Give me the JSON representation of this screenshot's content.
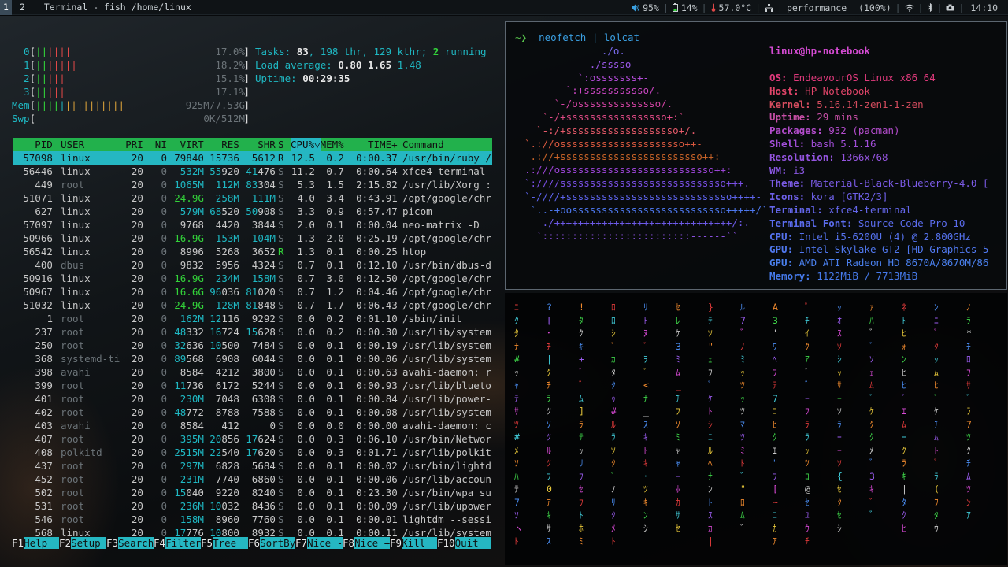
{
  "topbar": {
    "workspaces": [
      "1",
      "2"
    ],
    "active_workspace": "1",
    "window_title": "Terminal - fish /home/linux",
    "volume": "95%",
    "battery": "14%",
    "temperature": "57.0°C",
    "governor": "performance",
    "governor_pct": "(100%)",
    "time": "14:10"
  },
  "htop": {
    "cpus": [
      {
        "label": "0",
        "pct": "17.0%",
        "bars": [
          [
            "g",
            "||"
          ],
          [
            "r",
            "||||"
          ]
        ]
      },
      {
        "label": "1",
        "pct": "18.2%",
        "bars": [
          [
            "g",
            "||"
          ],
          [
            "r",
            "|||||"
          ]
        ]
      },
      {
        "label": "2",
        "pct": "15.1%",
        "bars": [
          [
            "g",
            "||"
          ],
          [
            "r",
            "|||"
          ]
        ]
      },
      {
        "label": "3",
        "pct": "17.1%",
        "bars": [
          [
            "g",
            "||"
          ],
          [
            "r",
            "|||"
          ]
        ]
      }
    ],
    "mem": {
      "label": "Mem",
      "value": "925M/7.53G",
      "bars": [
        [
          "g",
          "||||"
        ],
        [
          "c",
          "|"
        ],
        [
          "o",
          "||||||||||"
        ]
      ]
    },
    "swp": {
      "label": "Swp",
      "value": "0K/512M"
    },
    "tasks_label": "Tasks: ",
    "tasks": "83",
    "tasks_rest": ", 198 thr, 129 kthr; ",
    "running": "2",
    "running_label": " running",
    "load_label": "Load average: ",
    "load1": "0.80",
    "load5": "1.65",
    "load15": "1.48",
    "uptime_label": "Uptime: ",
    "uptime": "00:29:35",
    "columns": [
      "PID",
      "USER",
      "PRI",
      "NI",
      "VIRT",
      "RES",
      "SHR",
      "S",
      "CPU%▽",
      "MEM%",
      "TIME+",
      "Command"
    ],
    "processes": [
      [
        "57098",
        "linux",
        "20",
        "0",
        "79840",
        "15736",
        "5612",
        "R",
        "12.5",
        "0.2",
        "0:00.37",
        "/usr/bin/ruby /"
      ],
      [
        "56446",
        "linux",
        "20",
        "0",
        "532M",
        "55920",
        "41476",
        "S",
        "11.2",
        "0.7",
        "0:00.64",
        "xfce4-terminal"
      ],
      [
        "449",
        "root",
        "20",
        "0",
        "1065M",
        "112M",
        "83304",
        "S",
        "5.3",
        "1.5",
        "2:15.82",
        "/usr/lib/Xorg :"
      ],
      [
        "51071",
        "linux",
        "20",
        "0",
        "24.9G",
        "258M",
        "111M",
        "S",
        "4.0",
        "3.4",
        "0:43.91",
        "/opt/google/chr"
      ],
      [
        "627",
        "linux",
        "20",
        "0",
        "579M",
        "68520",
        "50908",
        "S",
        "3.3",
        "0.9",
        "0:57.47",
        "picom"
      ],
      [
        "57097",
        "linux",
        "20",
        "0",
        "9768",
        "4420",
        "3844",
        "S",
        "2.0",
        "0.1",
        "0:00.04",
        "neo-matrix -D"
      ],
      [
        "50966",
        "linux",
        "20",
        "0",
        "16.9G",
        "153M",
        "104M",
        "S",
        "1.3",
        "2.0",
        "0:25.19",
        "/opt/google/chr"
      ],
      [
        "56542",
        "linux",
        "20",
        "0",
        "8996",
        "5268",
        "3652",
        "R",
        "1.3",
        "0.1",
        "0:00.25",
        "htop"
      ],
      [
        "400",
        "dbus",
        "20",
        "0",
        "9832",
        "5956",
        "4324",
        "S",
        "0.7",
        "0.1",
        "0:12.10",
        "/usr/bin/dbus-d"
      ],
      [
        "50916",
        "linux",
        "20",
        "0",
        "16.9G",
        "234M",
        "158M",
        "S",
        "0.7",
        "3.0",
        "0:12.50",
        "/opt/google/chr"
      ],
      [
        "50967",
        "linux",
        "20",
        "0",
        "16.6G",
        "96036",
        "81020",
        "S",
        "0.7",
        "1.2",
        "0:04.46",
        "/opt/google/chr"
      ],
      [
        "51032",
        "linux",
        "20",
        "0",
        "24.9G",
        "128M",
        "81848",
        "S",
        "0.7",
        "1.7",
        "0:06.43",
        "/opt/google/chr"
      ],
      [
        "1",
        "root",
        "20",
        "0",
        "162M",
        "12116",
        "9292",
        "S",
        "0.0",
        "0.2",
        "0:01.10",
        "/sbin/init"
      ],
      [
        "237",
        "root",
        "20",
        "0",
        "48332",
        "16724",
        "15628",
        "S",
        "0.0",
        "0.2",
        "0:00.30",
        "/usr/lib/system"
      ],
      [
        "250",
        "root",
        "20",
        "0",
        "32636",
        "10500",
        "7484",
        "S",
        "0.0",
        "0.1",
        "0:00.19",
        "/usr/lib/system"
      ],
      [
        "368",
        "systemd-ti",
        "20",
        "0",
        "89568",
        "6908",
        "6044",
        "S",
        "0.0",
        "0.1",
        "0:00.06",
        "/usr/lib/system"
      ],
      [
        "398",
        "avahi",
        "20",
        "0",
        "8584",
        "4212",
        "3800",
        "S",
        "0.0",
        "0.1",
        "0:00.63",
        "avahi-daemon: r"
      ],
      [
        "399",
        "root",
        "20",
        "0",
        "11736",
        "6172",
        "5244",
        "S",
        "0.0",
        "0.1",
        "0:00.93",
        "/usr/lib/blueto"
      ],
      [
        "401",
        "root",
        "20",
        "0",
        "230M",
        "7048",
        "6308",
        "S",
        "0.0",
        "0.1",
        "0:00.84",
        "/usr/lib/power-"
      ],
      [
        "402",
        "root",
        "20",
        "0",
        "48772",
        "8788",
        "7588",
        "S",
        "0.0",
        "0.1",
        "0:00.08",
        "/usr/lib/system"
      ],
      [
        "403",
        "avahi",
        "20",
        "0",
        "8584",
        "412",
        "0",
        "S",
        "0.0",
        "0.0",
        "0:00.00",
        "avahi-daemon: c"
      ],
      [
        "407",
        "root",
        "20",
        "0",
        "395M",
        "20856",
        "17624",
        "S",
        "0.0",
        "0.3",
        "0:06.10",
        "/usr/bin/Networ"
      ],
      [
        "408",
        "polkitd",
        "20",
        "0",
        "2515M",
        "22540",
        "17620",
        "S",
        "0.0",
        "0.3",
        "0:01.71",
        "/usr/lib/polkit"
      ],
      [
        "437",
        "root",
        "20",
        "0",
        "297M",
        "6828",
        "5684",
        "S",
        "0.0",
        "0.1",
        "0:00.02",
        "/usr/bin/lightd"
      ],
      [
        "452",
        "root",
        "20",
        "0",
        "231M",
        "7740",
        "6860",
        "S",
        "0.0",
        "0.1",
        "0:00.06",
        "/usr/lib/accoun"
      ],
      [
        "502",
        "root",
        "20",
        "0",
        "15040",
        "9220",
        "8240",
        "S",
        "0.0",
        "0.1",
        "0:23.30",
        "/usr/bin/wpa_su"
      ],
      [
        "531",
        "root",
        "20",
        "0",
        "236M",
        "10032",
        "8436",
        "S",
        "0.0",
        "0.1",
        "0:00.09",
        "/usr/lib/upower"
      ],
      [
        "546",
        "root",
        "20",
        "0",
        "158M",
        "8960",
        "7760",
        "S",
        "0.0",
        "0.1",
        "0:00.01",
        "lightdm --sessi"
      ],
      [
        "568",
        "linux",
        "20",
        "0",
        "17776",
        "10800",
        "8932",
        "S",
        "0.0",
        "0.1",
        "0:00.11",
        "/usr/lib/system"
      ]
    ],
    "fkeys": [
      [
        "F1",
        "Help  "
      ],
      [
        "F2",
        "Setup "
      ],
      [
        "F3",
        "Search"
      ],
      [
        "F4",
        "Filter"
      ],
      [
        "F5",
        "Tree  "
      ],
      [
        "F6",
        "SortBy"
      ],
      [
        "F7",
        "Nice -"
      ],
      [
        "F8",
        "Nice +"
      ],
      [
        "F9",
        "Kill  "
      ],
      [
        "F10",
        "Quit  "
      ]
    ]
  },
  "neofetch": {
    "prompt": "~❯",
    "command": "neofetch | lolcat",
    "logo": [
      "             ./o.",
      "           ./sssso-",
      "         `:osssssss+-",
      "       `:+sssssssssso/.",
      "     `-/ossssssssssssso/.",
      "   `-/+sssssssssssssssso+:`",
      "  `-:/+sssssssssssssssssso+/.",
      "`.://osssssssssssssssssssso++-",
      " .://+ssssssssssssssssssssssso++:",
      ".:///ossssssssssssssssssssssssso++:",
      "`:////ssssssssssssssssssssssssssso+++.",
      "`-////+ssssssssssssssssssssssssssso++++-",
      " `..-+oossssssssssssssssssssssssso+++++/`",
      "   ./++++++++++++++++++++++++++++++/:.",
      "  `:::::::::::::::::::::::::------``"
    ],
    "user_host": "linux@hp-notebook",
    "separator": "-----------------",
    "info": [
      [
        "OS",
        "EndeavourOS Linux x86_64"
      ],
      [
        "Host",
        "HP Notebook"
      ],
      [
        "Kernel",
        "5.16.14-zen1-1-zen"
      ],
      [
        "Uptime",
        "29 mins"
      ],
      [
        "Packages",
        "932 (pacman)"
      ],
      [
        "Shell",
        "bash 5.1.16"
      ],
      [
        "Resolution",
        "1366x768"
      ],
      [
        "WM",
        "i3"
      ],
      [
        "Theme",
        "Material-Black-Blueberry-4.0 ["
      ],
      [
        "Icons",
        "kora [GTK2/3]"
      ],
      [
        "Terminal",
        "xfce4-terminal"
      ],
      [
        "Terminal Font",
        "Source Code Pro 10"
      ],
      [
        "CPU",
        "Intel i5-6200U (4) @ 2.800GHz"
      ],
      [
        "GPU",
        "Intel Skylake GT2 [HD Graphics 5"
      ],
      [
        "GPU",
        "AMD ATI Radeon HD 8670A/8670M/86"
      ],
      [
        "Memory",
        "1122MiB / 7713MiB"
      ]
    ]
  },
  "matrix": {
    "columns": [
      [
        "ﾆ",
        "ｸ",
        "ﾀ",
        "ﾅ",
        "#",
        "ｯ",
        "ｬ",
        "ﾃ",
        "ｻ",
        "ﾂ",
        "#",
        "ﾒ",
        "ｿ",
        "ﾊ",
        "ﾃ",
        "7",
        "ｿ",
        "ヽ",
        "ﾄ"
      ],
      [
        "?",
        "[",
        "･",
        "ﾁ",
        "|",
        "ｸ",
        "ﾁ",
        "ﾗ",
        "ﾂ",
        "ｿ",
        "ﾂ",
        "ﾙ",
        "ﾂ",
        "ﾌ",
        "0",
        "ｱ",
        "ｷ",
        "ｻ",
        "ｽ"
      ],
      [
        "!",
        "ﾀ",
        "ｸ",
        "ｷ",
        "+",
        "ﾞ",
        "ﾞ",
        "ﾑ",
        "]",
        "ﾗ",
        "ﾃ",
        "ｯ",
        "ﾘ",
        "ﾌ",
        "ｾ",
        "ﾌ",
        "ﾄ",
        "ﾎ",
        "ﾐ"
      ],
      [
        "ﾛ",
        "ﾛ",
        "ｼ",
        "ﾞ",
        "ｶ",
        "ﾀ",
        "ｸ",
        "ｩ",
        "#",
        "ﾙ",
        "ﾗ",
        "ﾂ",
        "ｸ",
        "ﾞ",
        "ﾉ",
        "ﾘ",
        "ｸ",
        "ﾒ",
        "ﾄ"
      ],
      [
        "ﾘ",
        "ﾄ",
        "ﾇ",
        "ﾞ",
        "ｦ",
        "ﾞ",
        "<",
        "ﾅ",
        "_",
        "ｽ",
        "ｷ",
        "ﾄ",
        "ｷ",
        "･",
        "ﾂ",
        "ｷ",
        "ﾝ",
        "ｼ"
      ],
      [
        "ｾ",
        "ﾚ",
        "ｹ",
        "3",
        "ﾐ",
        "ﾑ",
        "_",
        "ﾁ",
        "ﾌ",
        "ｿ",
        "ﾐ",
        "ｬ",
        "ｬ",
        "ｰ",
        "ﾎ",
        "ｶ",
        "ｻ",
        "ｾ"
      ],
      [
        "}",
        "ﾃ",
        "ﾂ",
        "\"",
        "ｪ",
        "ﾌ",
        "ﾞ",
        "ｹ",
        "ﾄ",
        "ｼ",
        "ﾆ",
        "ﾙ",
        "ﾍ",
        "ﾅ",
        "ﾝ",
        "ﾄ",
        "ｽ",
        "ｶ",
        "|"
      ],
      [
        "ﾙ",
        "7",
        "ﾞ",
        "ﾉ",
        "ﾐ",
        "ｯ",
        "ﾂ",
        "ｯ",
        "ﾂ",
        "ﾏ",
        "ﾂ",
        "ﾐ",
        "ﾄ",
        "ﾞ",
        "\"",
        "ﾛ",
        "ﾑ",
        "ﾞ"
      ],
      [
        "A",
        "3",
        "'",
        "ﾜ",
        "ﾍ",
        "ﾌ",
        "ﾃ",
        "7",
        "ｺ",
        "ﾋ",
        "ｸ",
        "ｴ",
        "\"",
        "ﾌ",
        "[",
        "~",
        "ﾆ",
        "ｶ",
        "ｱ"
      ],
      [
        "ﾟ",
        "ﾁ",
        "ｲ",
        "ｸ",
        "ｱ",
        "ﾞ",
        "ﾞ",
        "ｰ",
        "ﾌ",
        "ﾗ",
        "ﾗ",
        "ｯ",
        "ﾂ",
        "ｺ",
        "@",
        "ｾ",
        "ﾕ",
        "ｳ",
        "ﾁ"
      ],
      [
        "ｯ",
        "ｵ",
        "ｽ",
        "ﾂ",
        "ｼ",
        "ｯ",
        "ｻ",
        "ｰ",
        "ﾂ",
        "ﾗ",
        "ｰ",
        "ｰ",
        "ﾂ",
        "{",
        "ｾ",
        "ｸ",
        "ｾ",
        "ｼ"
      ],
      [
        "ｧ",
        "ﾊ",
        "ﾞ",
        "ﾞ",
        "ｿ",
        "ｪ",
        "ﾑ",
        "ﾞ",
        "ｹ",
        "ｸ",
        "ｸ",
        "ﾒ",
        "ﾞ",
        "3",
        "ｷ",
        "ﾞ",
        "ﾞ"
      ],
      [
        "ﾈ",
        "ﾄ",
        "ﾋ",
        "ｫ",
        "ﾝ",
        "ﾋ",
        "ﾋ",
        "ﾞ",
        "ｴ",
        "ﾑ",
        "ｰ",
        "ｸ",
        "ﾗ",
        "ｷ",
        "|",
        "ﾀ",
        "ｸ",
        "ﾋ"
      ],
      [
        "ﾝ",
        "ﾆ",
        "ﾞ",
        "ｸ",
        "ｯ",
        "ﾑ",
        "ﾋ",
        "ﾞ",
        "ｹ",
        "ﾁ",
        "ﾑ",
        "ﾄ",
        "ﾞ",
        "ﾗ",
        "(",
        "ｦ",
        "ﾀ",
        "ｳ"
      ],
      [
        "ﾉ",
        "ﾗ",
        "*",
        "ﾁ",
        "ﾛ",
        "ﾌ",
        "ｻ",
        "ﾞ",
        "ﾗ",
        "7",
        "ﾂ",
        "ｸ",
        "ﾁ",
        "ﾑ",
        "ﾂ",
        "ﾝ",
        "ｱ"
      ]
    ]
  },
  "colors": {
    "green": "#33d33a",
    "red": "#e04848",
    "cyan": "#25b7c2",
    "header_bg": "#22b14c"
  }
}
